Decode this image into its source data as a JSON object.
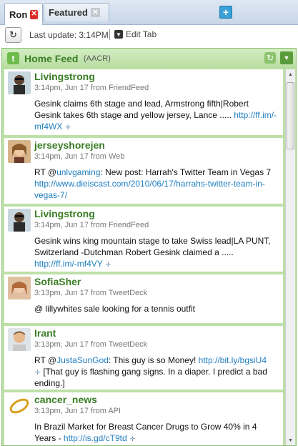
{
  "tabs": [
    {
      "label": "Ron"
    },
    {
      "label": "Featured"
    }
  ],
  "toolbar": {
    "last_update": "Last update: 3:14PM",
    "edit_tab": "Edit Tab"
  },
  "feed": {
    "title": "Home Feed",
    "subtitle": "(AACR)",
    "items": [
      {
        "user": "Livingstrong",
        "meta": "3:14pm, Jun 17 from FriendFeed",
        "text": "Gesink claims 6th stage and lead, Armstrong fifth|Robert Gesink takes 6th stage and yellow jersey, Lance ..... ",
        "link": "http://ff.im/-mf4WX",
        "avatar": "cyclist-avatar"
      },
      {
        "user": "jerseyshorejen",
        "meta": "3:14pm, Jun 17 from Web",
        "text_prefix": "RT @",
        "mention": "unlvgaming",
        "text": ": New post: Harrah's Twitter Team in Vegas 7 ",
        "link": "http://www.dieiscast.com/2010/06/17/harrahs-twitter-team-in-vegas-7/",
        "avatar": "woman-avatar"
      },
      {
        "user": "Livingstrong",
        "meta": "3:14pm, Jun 17 from FriendFeed",
        "text": "Gesink wins king mountain stage to take Swiss lead|LA PUNT, Switzerland -Dutchman Robert Gesink claimed a ..... ",
        "link": "http://ff.im/-mf4VY",
        "avatar": "cyclist-avatar"
      },
      {
        "user": "SofiaSher",
        "meta": "3:13pm, Jun 17 from TweetDeck",
        "text": "@ lillywhites sale looking for a tennis outfit",
        "avatar": "woman-avatar-2"
      },
      {
        "user": "Irant",
        "meta": "3:13pm, Jun 17 from TweetDeck",
        "text_prefix": "RT @",
        "mention": "JustaSunGod",
        "text": ": This guy is so Money! ",
        "link": "http://bit.ly/bgsiU4",
        "text_after": " [That guy is flashing gang signs. In a diaper. I predict a bad ending.]",
        "avatar": "man-avatar"
      },
      {
        "user": "cancer_news",
        "meta": "3:13pm, Jun 17 from API",
        "text": "In Brazil Market for Breast Cancer Drugs to Grow 40% in 4 Years - ",
        "link": "http://is.gd/cT9td",
        "avatar": "ribbon-avatar"
      }
    ]
  },
  "colors": {
    "accent_green": "#3a7d25",
    "link_blue": "#1f7fc1",
    "close_red": "#d9302a",
    "add_blue": "#3ba0d5"
  }
}
